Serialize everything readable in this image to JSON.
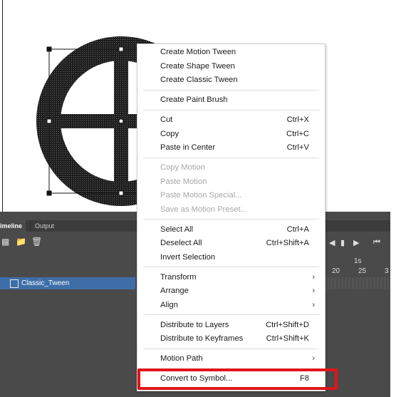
{
  "timeline": {
    "tabs": [
      "imeline",
      "Output"
    ],
    "toolbar_icons": [
      "new-layer-icon",
      "folder-icon",
      "trash-icon"
    ],
    "layer_name": "Classic_Tween",
    "frame_label": "1s",
    "ruler_numbers": [
      "20",
      "25",
      "3"
    ],
    "playback_icons": [
      "step-back-icon",
      "play-icon",
      "step-forward-icon",
      "rewind-icon"
    ]
  },
  "colors": {
    "highlight": "#e0141a",
    "layer_selected": "#3e6ea8",
    "panel_bg": "#4a4a4a"
  },
  "context_menu": {
    "groups": [
      [
        {
          "label": "Create Motion Tween",
          "shortcut": "",
          "disabled": false,
          "submenu": false
        },
        {
          "label": "Create Shape Tween",
          "shortcut": "",
          "disabled": false,
          "submenu": false
        },
        {
          "label": "Create Classic Tween",
          "shortcut": "",
          "disabled": false,
          "submenu": false
        }
      ],
      [
        {
          "label": "Create Paint Brush",
          "shortcut": "",
          "disabled": false,
          "submenu": false
        }
      ],
      [
        {
          "label": "Cut",
          "shortcut": "Ctrl+X",
          "disabled": false,
          "submenu": false
        },
        {
          "label": "Copy",
          "shortcut": "Ctrl+C",
          "disabled": false,
          "submenu": false
        },
        {
          "label": "Paste in Center",
          "shortcut": "Ctrl+V",
          "disabled": false,
          "submenu": false
        }
      ],
      [
        {
          "label": "Copy Motion",
          "shortcut": "",
          "disabled": true,
          "submenu": false
        },
        {
          "label": "Paste Motion",
          "shortcut": "",
          "disabled": true,
          "submenu": false
        },
        {
          "label": "Paste Motion Special...",
          "shortcut": "",
          "disabled": true,
          "submenu": false
        },
        {
          "label": "Save as Motion Preset...",
          "shortcut": "",
          "disabled": true,
          "submenu": false
        }
      ],
      [
        {
          "label": "Select All",
          "shortcut": "Ctrl+A",
          "disabled": false,
          "submenu": false
        },
        {
          "label": "Deselect All",
          "shortcut": "Ctrl+Shift+A",
          "disabled": false,
          "submenu": false
        },
        {
          "label": "Invert Selection",
          "shortcut": "",
          "disabled": false,
          "submenu": false
        }
      ],
      [
        {
          "label": "Transform",
          "shortcut": "",
          "disabled": false,
          "submenu": true
        },
        {
          "label": "Arrange",
          "shortcut": "",
          "disabled": false,
          "submenu": true
        },
        {
          "label": "Align",
          "shortcut": "",
          "disabled": false,
          "submenu": true
        }
      ],
      [
        {
          "label": "Distribute to Layers",
          "shortcut": "Ctrl+Shift+D",
          "disabled": false,
          "submenu": false
        },
        {
          "label": "Distribute to Keyframes",
          "shortcut": "Ctrl+Shift+K",
          "disabled": false,
          "submenu": false
        }
      ],
      [
        {
          "label": "Motion Path",
          "shortcut": "",
          "disabled": false,
          "submenu": true
        }
      ],
      [
        {
          "label": "Convert to Symbol...",
          "shortcut": "F8",
          "disabled": false,
          "submenu": false
        }
      ]
    ]
  }
}
